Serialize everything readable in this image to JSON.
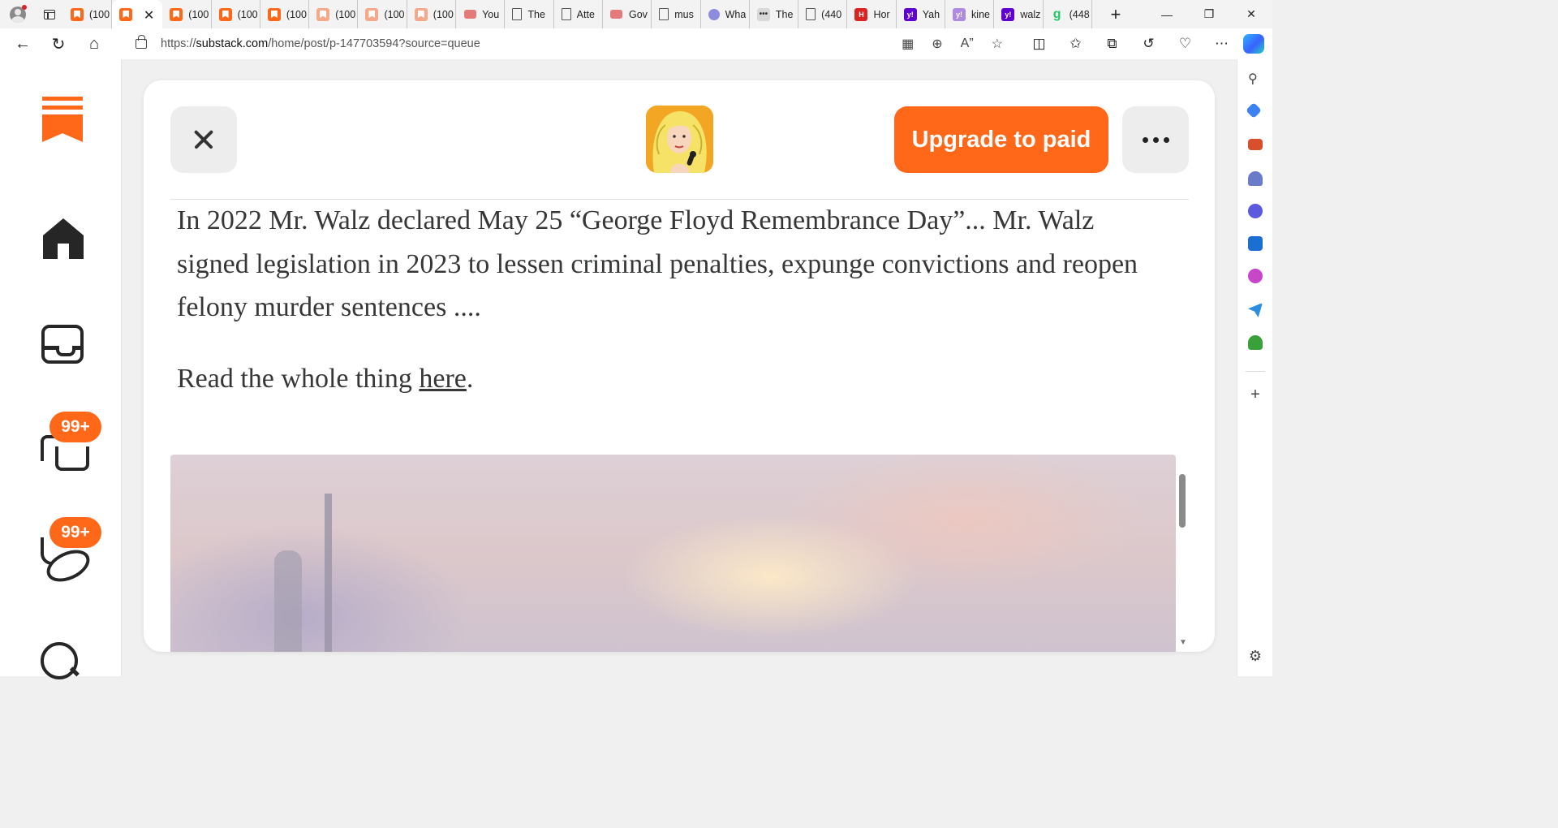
{
  "browser": {
    "tabs": [
      {
        "favicon": "substack-icon",
        "title": "(100"
      },
      {
        "favicon": "substack-icon",
        "title": "",
        "active": true
      },
      {
        "favicon": "substack-icon",
        "title": "(100"
      },
      {
        "favicon": "substack-icon",
        "title": "(100"
      },
      {
        "favicon": "substack-icon",
        "title": "(100"
      },
      {
        "favicon": "substack-icon-light",
        "title": "(100"
      },
      {
        "favicon": "substack-icon-light",
        "title": "(100"
      },
      {
        "favicon": "substack-icon-light",
        "title": "(100"
      },
      {
        "favicon": "youtube-icon",
        "title": "You"
      },
      {
        "favicon": "document-icon",
        "title": "The"
      },
      {
        "favicon": "document-icon",
        "title": "Atte"
      },
      {
        "favicon": "youtube-icon",
        "title": "Gov"
      },
      {
        "favicon": "document-icon",
        "title": "mus"
      },
      {
        "favicon": "orb-icon",
        "title": "Wha"
      },
      {
        "favicon": "dots-icon",
        "title": "The"
      },
      {
        "favicon": "document-icon",
        "title": "(440"
      },
      {
        "favicon": "hm-icon",
        "title": "Hor"
      },
      {
        "favicon": "yahoo-icon",
        "title": "Yah"
      },
      {
        "favicon": "yahoo-icon-light",
        "title": "kine"
      },
      {
        "favicon": "yahoo-icon",
        "title": "walz"
      },
      {
        "favicon": "grammarly-icon",
        "title": "(448"
      }
    ],
    "url_prefix": "https://",
    "url_host": "substack.com",
    "url_path": "/home/post/p-147703594?source=queue"
  },
  "leftnav": {
    "chat_badge": "99+",
    "activity_badge": "99+"
  },
  "header": {
    "upgrade_label": "Upgrade to paid"
  },
  "article": {
    "paragraph1": "In 2022 Mr. Walz declared May 25 “George Floyd Remembrance Day”... Mr. Walz signed legislation in 2023 to lessen criminal penalties, expunge convictions and reopen felony murder sentences ....",
    "paragraph2_before": "Read the whole thing ",
    "paragraph2_link": "here",
    "paragraph2_after": "."
  },
  "colors": {
    "accent": "#ff6719",
    "text": "#363737"
  }
}
